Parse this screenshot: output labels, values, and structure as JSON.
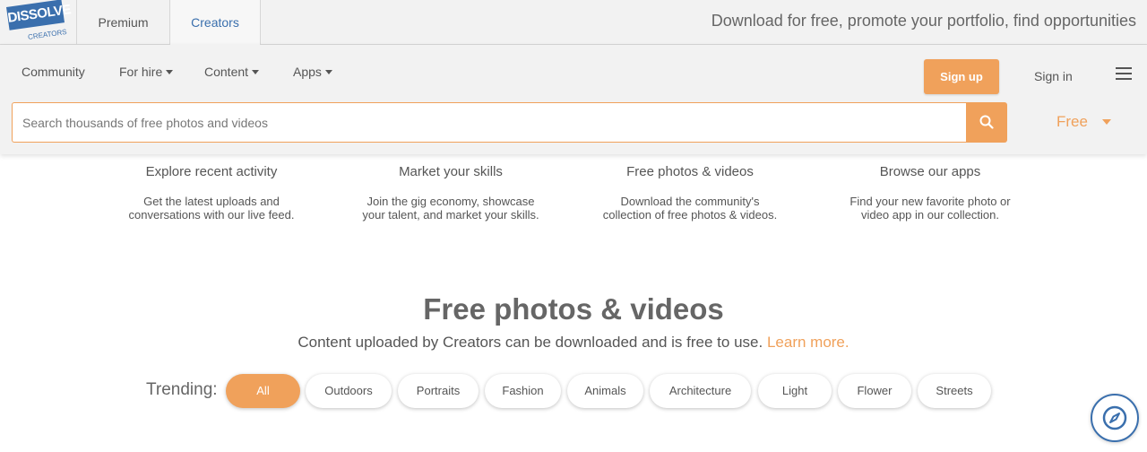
{
  "brand": {
    "name": "DISSOLVE",
    "sub": "CREATORS"
  },
  "top_tabs": [
    {
      "label": "Premium"
    },
    {
      "label": "Creators"
    }
  ],
  "tagline": "Download for free, promote your portfolio, find opportunities",
  "nav": {
    "community": "Community",
    "for_hire": "For hire",
    "content": "Content",
    "apps": "Apps",
    "sign_up": "Sign up",
    "sign_in": "Sign in"
  },
  "search": {
    "placeholder": "Search thousands of free photos and videos",
    "filter": "Free"
  },
  "features": [
    {
      "title": "Explore recent activity",
      "line1": "Get the latest uploads and",
      "line2": "conversations with our live feed."
    },
    {
      "title": "Market your skills",
      "line1": "Join the gig economy, showcase",
      "line2": "your talent, and market your skills."
    },
    {
      "title": "Free photos & videos",
      "line1": "Download the community's",
      "line2": "collection of free photos & videos."
    },
    {
      "title": "Browse our apps",
      "line1": "Find your new favorite photo or",
      "line2": "video app in our collection."
    }
  ],
  "hero": {
    "title": "Free photos & videos",
    "subtitle": "Content uploaded by Creators can be downloaded and is free to use.",
    "link": "Learn more."
  },
  "trending": {
    "label": "Trending:",
    "chips": [
      "All",
      "Outdoors",
      "Portraits",
      "Fashion",
      "Animals",
      "Architecture",
      "Light",
      "Flower",
      "Streets"
    ],
    "active": "All"
  },
  "colors": {
    "accent": "#f0a15b",
    "brand": "#3a6fad"
  },
  "icons": {
    "search": "search-icon",
    "menu": "hamburger-menu-icon",
    "compass": "compass-icon"
  }
}
